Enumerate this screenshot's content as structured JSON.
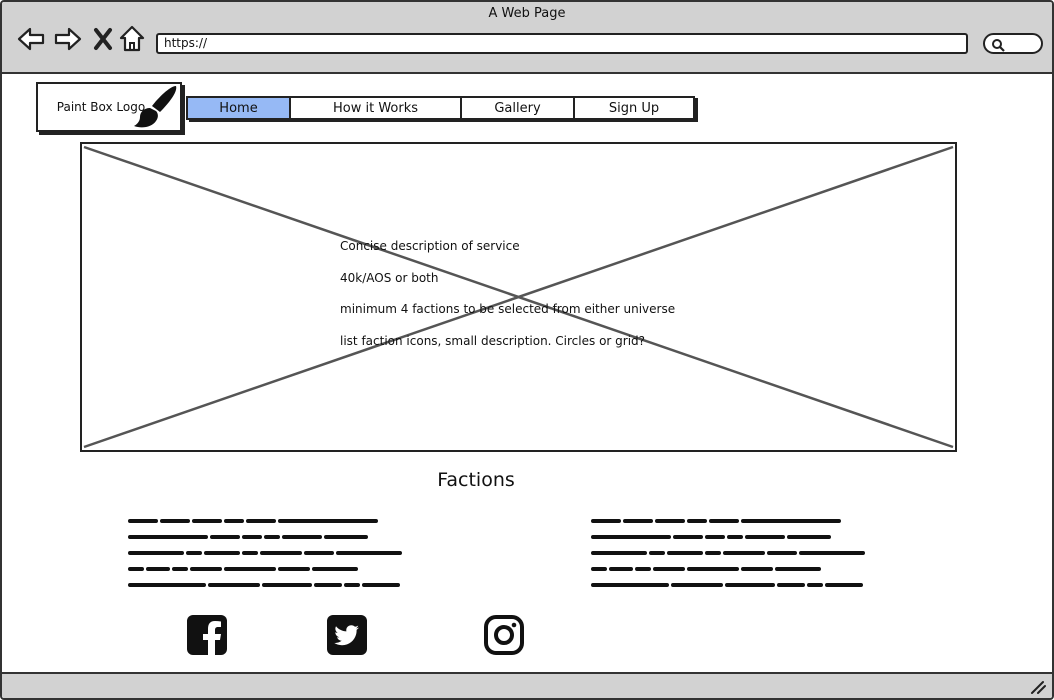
{
  "window": {
    "title": "A Web Page"
  },
  "browser": {
    "address": "https://",
    "icons": [
      "back-arrow-icon",
      "forward-arrow-icon",
      "close-x-icon",
      "home-icon",
      "search-icon"
    ]
  },
  "logo": {
    "label": "Paint Box Logo",
    "icon": "paintbrush-icon"
  },
  "nav": {
    "items": [
      {
        "label": "Home",
        "active": true
      },
      {
        "label": "How it Works",
        "active": false
      },
      {
        "label": "Gallery",
        "active": false
      },
      {
        "label": "Sign Up",
        "active": false
      }
    ]
  },
  "hero": {
    "lines": [
      "Concise description of service",
      "40k/AOS or both",
      "minimum 4 factions to be selected from either universe",
      "list faction icons, small description. Circles or grid?"
    ]
  },
  "factions": {
    "title": "Factions"
  },
  "social": {
    "icons": [
      "facebook-icon",
      "twitter-icon",
      "instagram-icon"
    ]
  },
  "colors": {
    "chrome": "#d2d2d2",
    "active_nav": "#96b9f5",
    "ink": "#222222"
  }
}
